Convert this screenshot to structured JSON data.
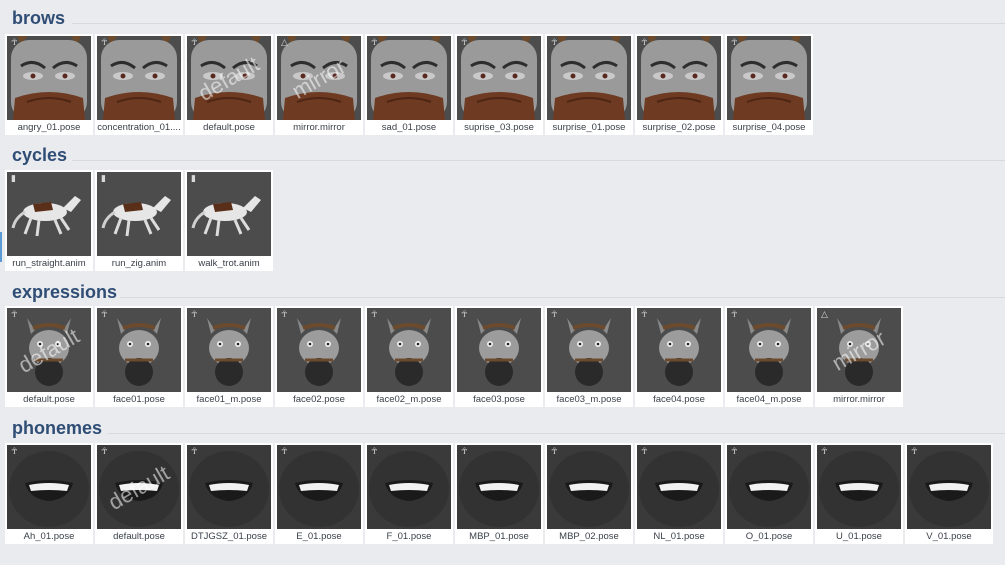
{
  "sections": [
    {
      "title": "brows",
      "kind": "brow",
      "items": [
        {
          "label": "angry_01.pose",
          "badge": "pose-icon",
          "overlay": ""
        },
        {
          "label": "concentration_01....",
          "badge": "pose-icon",
          "overlay": ""
        },
        {
          "label": "default.pose",
          "badge": "pose-icon",
          "overlay": "default"
        },
        {
          "label": "mirror.mirror",
          "badge": "mirror-icon",
          "overlay": "mirror"
        },
        {
          "label": "sad_01.pose",
          "badge": "pose-icon",
          "overlay": ""
        },
        {
          "label": "suprise_03.pose",
          "badge": "pose-icon",
          "overlay": ""
        },
        {
          "label": "surprise_01.pose",
          "badge": "pose-icon",
          "overlay": ""
        },
        {
          "label": "surprise_02.pose",
          "badge": "pose-icon",
          "overlay": ""
        },
        {
          "label": "surprise_04.pose",
          "badge": "pose-icon",
          "overlay": ""
        }
      ]
    },
    {
      "title": "cycles",
      "kind": "horse",
      "items": [
        {
          "label": "run_straight.anim",
          "badge": "anim-icon",
          "overlay": ""
        },
        {
          "label": "run_zig.anim",
          "badge": "anim-icon",
          "overlay": ""
        },
        {
          "label": "walk_trot.anim",
          "badge": "anim-icon",
          "overlay": ""
        }
      ]
    },
    {
      "title": "expressions",
      "kind": "face",
      "items": [
        {
          "label": "default.pose",
          "badge": "pose-icon",
          "overlay": "default"
        },
        {
          "label": "face01.pose",
          "badge": "pose-icon",
          "overlay": ""
        },
        {
          "label": "face01_m.pose",
          "badge": "pose-icon",
          "overlay": ""
        },
        {
          "label": "face02.pose",
          "badge": "pose-icon",
          "overlay": ""
        },
        {
          "label": "face02_m.pose",
          "badge": "pose-icon",
          "overlay": ""
        },
        {
          "label": "face03.pose",
          "badge": "pose-icon",
          "overlay": ""
        },
        {
          "label": "face03_m.pose",
          "badge": "pose-icon",
          "overlay": ""
        },
        {
          "label": "face04.pose",
          "badge": "pose-icon",
          "overlay": ""
        },
        {
          "label": "face04_m.pose",
          "badge": "pose-icon",
          "overlay": ""
        },
        {
          "label": "mirror.mirror",
          "badge": "mirror-icon",
          "overlay": "mirror"
        }
      ]
    },
    {
      "title": "phonemes",
      "kind": "mouth",
      "items": [
        {
          "label": "Ah_01.pose",
          "badge": "pose-icon",
          "overlay": ""
        },
        {
          "label": "default.pose",
          "badge": "pose-icon",
          "overlay": "default"
        },
        {
          "label": "DTJGSZ_01.pose",
          "badge": "pose-icon",
          "overlay": ""
        },
        {
          "label": "E_01.pose",
          "badge": "pose-icon",
          "overlay": ""
        },
        {
          "label": "F_01.pose",
          "badge": "pose-icon",
          "overlay": ""
        },
        {
          "label": "MBP_01.pose",
          "badge": "pose-icon",
          "overlay": ""
        },
        {
          "label": "MBP_02.pose",
          "badge": "pose-icon",
          "overlay": ""
        },
        {
          "label": "NL_01.pose",
          "badge": "pose-icon",
          "overlay": ""
        },
        {
          "label": "O_01.pose",
          "badge": "pose-icon",
          "overlay": ""
        },
        {
          "label": "U_01.pose",
          "badge": "pose-icon",
          "overlay": ""
        },
        {
          "label": "V_01.pose",
          "badge": "pose-icon",
          "overlay": ""
        }
      ]
    }
  ],
  "colors": {
    "background": "#e9ebee",
    "header_text": "#2f4d75",
    "thumb_bg": "#4c4c4c",
    "label_text": "#3a3f48"
  }
}
